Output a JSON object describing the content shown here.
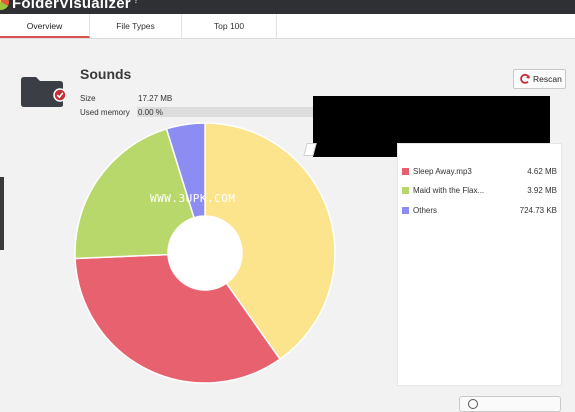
{
  "app": {
    "title": "FolderVisualizer",
    "title_mark": "?"
  },
  "tabs": [
    {
      "label": "Overview",
      "active": true
    },
    {
      "label": "File Types",
      "active": false
    },
    {
      "label": "Top 100",
      "active": false
    }
  ],
  "folder": {
    "name": "Sounds",
    "size_label": "Size",
    "size_value": "17.27 MB",
    "memory_label": "Used memory",
    "memory_value": "0.00 %",
    "memory_fraction": 0.0
  },
  "toolbar": {
    "rescan_label": "Rescan"
  },
  "watermark": "WWW.3UPK.COM",
  "colors": {
    "accent": "#d9534f",
    "titlebar": "#2f3033"
  },
  "chart_data": {
    "type": "pie",
    "categories": [
      "Sleep Away.mp3",
      "Maid with the Flax...",
      "Others"
    ],
    "values": [
      4.62,
      3.92,
      0.71
    ],
    "display_sizes": [
      "4.62 MB",
      "3.92 MB",
      "724.73 KB"
    ],
    "colors": [
      "#fbe48c",
      "#e8616f",
      "#b9d86b",
      "#8c8cf2"
    ],
    "donut": true
  },
  "chart_slices": [
    {
      "name": "Sleep Away.mp3",
      "value": 4.62,
      "color": "#fbe48c"
    },
    {
      "name": "Maid with the Flax...",
      "value": 3.92,
      "color": "#e8616f"
    },
    {
      "name": "Maid with the Flax...",
      "value": 2.4,
      "color": "#b9d86b"
    },
    {
      "name": "Others",
      "value": 0.55,
      "color": "#8c8cf2"
    }
  ],
  "legend": [
    {
      "name": "Sleep Away.mp3",
      "size": "4.62 MB",
      "color": "#e8616f"
    },
    {
      "name": "Maid with the Flax...",
      "size": "3.92 MB",
      "color": "#b9d86b"
    },
    {
      "name": "Others",
      "size": "724.73 KB",
      "color": "#8c8cf2"
    }
  ],
  "icons": {
    "folder": "folder-icon",
    "check": "check-badge-icon",
    "rescan": "refresh-icon",
    "bottom": "gear-icon"
  }
}
